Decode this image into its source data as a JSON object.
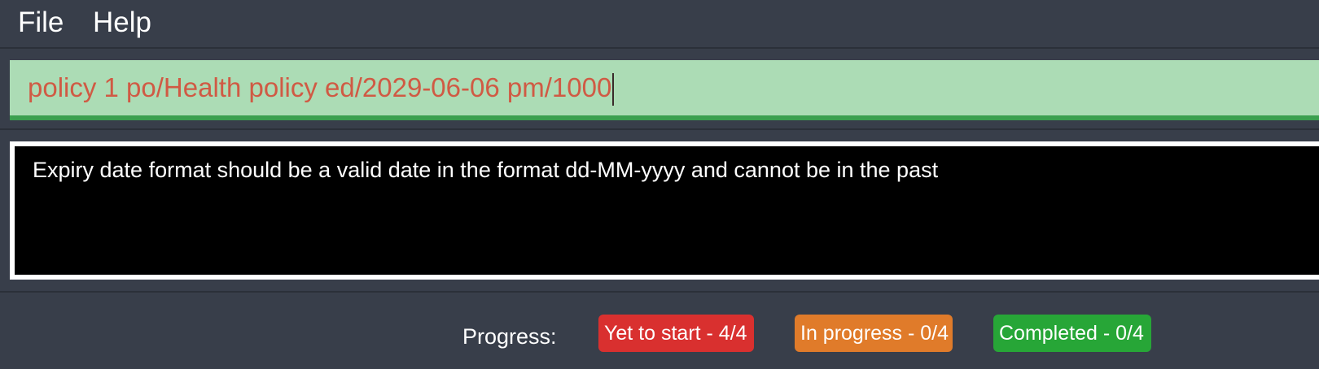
{
  "menu": {
    "file_label": "File",
    "help_label": "Help"
  },
  "command": {
    "value": "policy 1 po/Health policy ed/2029-06-06 pm/1000"
  },
  "result": {
    "message": "Expiry date format should be a valid date in the format dd-MM-yyyy and cannot be in the past"
  },
  "status": {
    "progress_label": "Progress:",
    "badges": [
      {
        "label": "Yet to start - 4/4",
        "color": "#d9302f"
      },
      {
        "label": "In progress - 0/4",
        "color": "#e07b2a"
      },
      {
        "label": "Completed - 0/4",
        "color": "#27a637"
      }
    ]
  },
  "colors": {
    "background": "#383e4a",
    "command_background": "#acdcb5",
    "command_text": "#d05a44",
    "result_background": "#000000"
  }
}
